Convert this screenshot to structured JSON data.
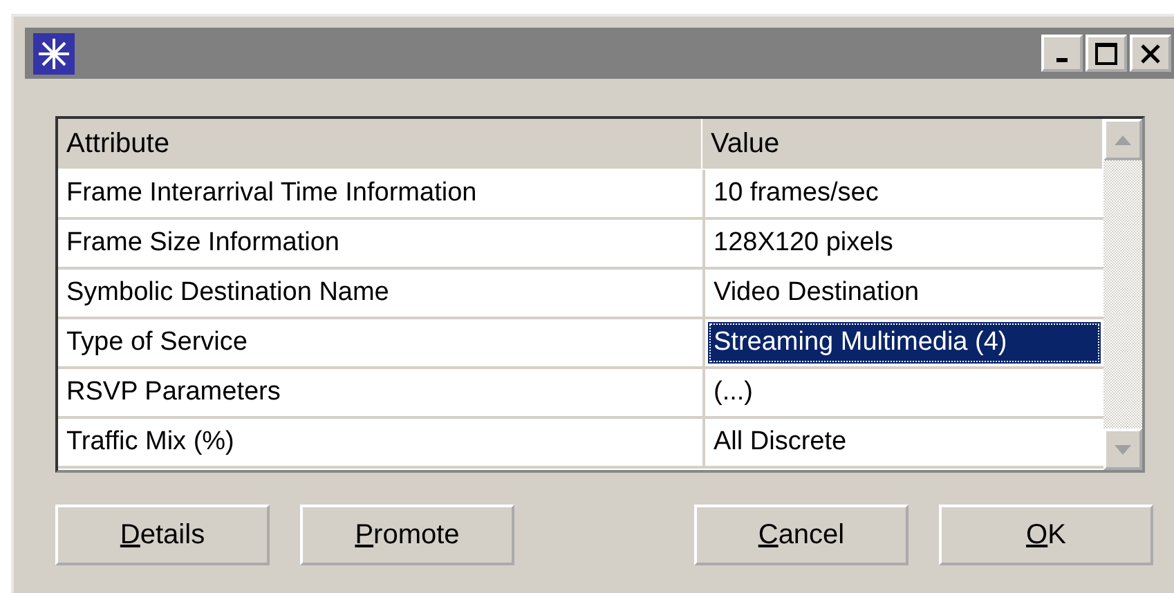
{
  "table": {
    "columns": [
      "Attribute",
      "Value"
    ],
    "rows": [
      {
        "attribute": "Frame Interarrival Time Information",
        "value": "10 frames/sec",
        "selected": false
      },
      {
        "attribute": "Frame Size Information",
        "value": "128X120 pixels",
        "selected": false
      },
      {
        "attribute": "Symbolic Destination Name",
        "value": "Video Destination",
        "selected": false
      },
      {
        "attribute": "Type of Service",
        "value": "Streaming Multimedia (4)",
        "selected": true
      },
      {
        "attribute": "RSVP Parameters",
        "value": "(...)",
        "selected": false
      },
      {
        "attribute": "Traffic Mix (%)",
        "value": "All Discrete",
        "selected": false
      }
    ]
  },
  "buttons": [
    "Details",
    "Promote",
    "Cancel",
    "OK"
  ]
}
